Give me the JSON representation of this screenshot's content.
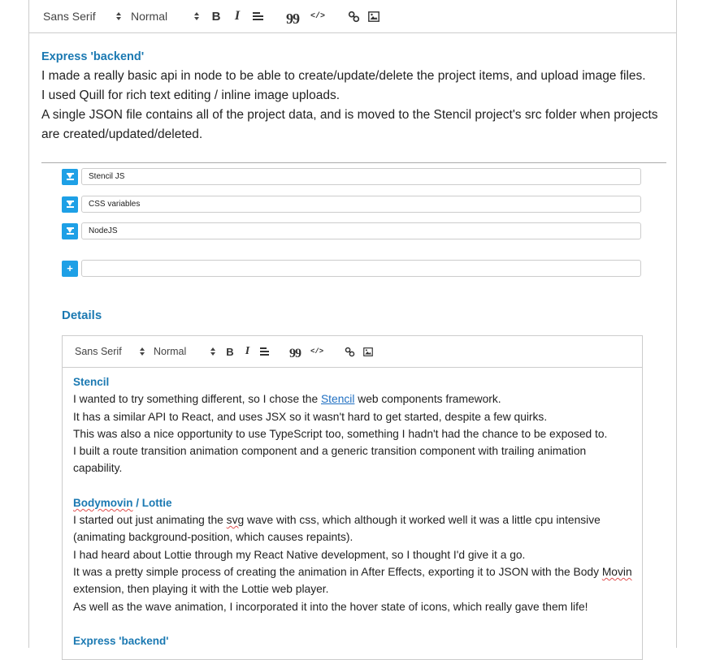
{
  "toolbar": {
    "font_family": "Sans Serif",
    "font_size": "Normal",
    "bold": "B",
    "italic": "I",
    "quote": "99",
    "code": "</>"
  },
  "summary_editor": {
    "heading": "Express 'backend'",
    "lines": [
      "I made a really basic api in node to be able to create/update/delete the project items, and upload image files.",
      "I used Quill for rich text editing / inline image uploads.",
      "A single JSON file contains all of the project data, and is moved to the Stencil project's src folder when projects are created/updated/deleted."
    ]
  },
  "tags": [
    {
      "value": "Stencil JS"
    },
    {
      "value": "CSS variables"
    },
    {
      "value": "NodeJS"
    }
  ],
  "new_tag": {
    "value": "",
    "add_label": "+"
  },
  "details": {
    "label": "Details",
    "toolbar": {
      "font_family": "Sans Serif",
      "font_size": "Normal",
      "bold": "B",
      "italic": "I",
      "quote": "99",
      "code": "</>"
    },
    "sections": [
      {
        "heading": "Stencil",
        "line1_before": "I wanted to try something different, so I chose the ",
        "line1_link": "Stencil",
        "line1_after": " web components framework.",
        "lines": [
          "It has a similar API to React, and uses JSX so it wasn't hard to get started, despite a few quirks.",
          "This was also a nice opportunity to use TypeScript too, something I hadn't had the chance to be exposed to.",
          "I built a route transition animation component and a generic transition component with trailing animation capability."
        ]
      },
      {
        "heading_a": "Bodymovin",
        "heading_b": " / Lottie",
        "lines_a": [
          "I started out just animating the ",
          "svg",
          " wave with css, which although it worked well it was a little cpu intensive (animating background-position, which causes repaints).",
          "I had heard about Lottie through my React Native development, so I thought I'd give it a go.",
          "It was a pretty simple process of creating the animation in After Effects, exporting it to JSON with the Body "
        ],
        "movin": "Movin",
        "lines_b": [
          " extension, then playing it with the Lottie web player.",
          "As well as the wave animation, I incorporated it into the hover state of icons, which really gave them life!"
        ]
      },
      {
        "heading": "Express 'backend'"
      }
    ]
  },
  "colors": {
    "accent": "#1b79b2",
    "badge": "#1ea0e6",
    "link": "#1f6fc2",
    "border": "#cccccc"
  }
}
